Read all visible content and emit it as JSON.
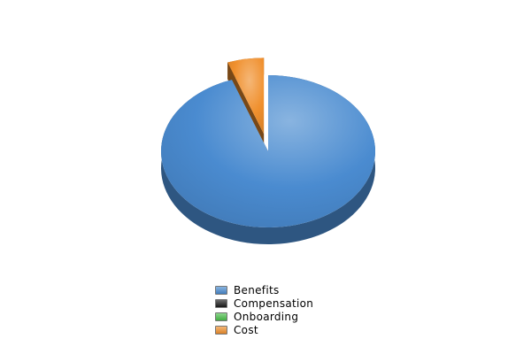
{
  "chart_data": {
    "type": "pie",
    "style": "3d",
    "title": "",
    "categories": [
      "Benefits",
      "Compensation",
      "Onboarding",
      "Cost"
    ],
    "values": [
      94.5,
      0,
      0,
      5.5
    ],
    "exploded": [
      "Cost"
    ],
    "colors": {
      "Benefits": "#4a8bd0",
      "Compensation": "#1c1c1c",
      "Onboarding": "#4cc04c",
      "Cost": "#f0902e"
    },
    "legend_position": "bottom",
    "legend": [
      {
        "label": "Benefits",
        "color": "#4a8bd0"
      },
      {
        "label": "Compensation",
        "color": "#1c1c1c"
      },
      {
        "label": "Onboarding",
        "color": "#4cc04c"
      },
      {
        "label": "Cost",
        "color": "#f0902e"
      }
    ]
  }
}
